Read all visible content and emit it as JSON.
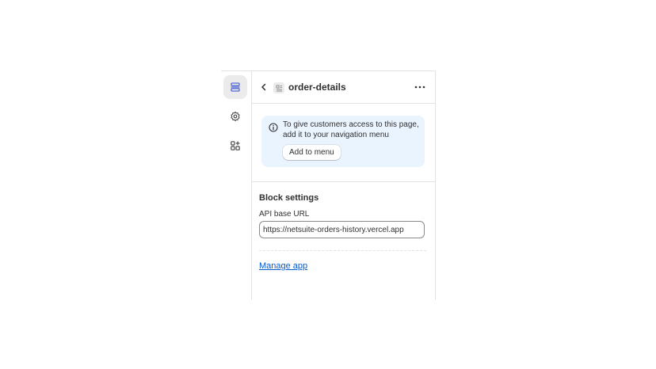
{
  "rail": {
    "items": [
      {
        "name": "sections",
        "icon": "sections-icon",
        "active": true
      },
      {
        "name": "settings",
        "icon": "gear-icon",
        "active": false
      },
      {
        "name": "apps",
        "icon": "app-add-icon",
        "active": false
      }
    ]
  },
  "header": {
    "title": "order-details",
    "back_icon": "chevron-left-icon",
    "page_icon": "page-icon",
    "more_icon": "more-horizontal-icon"
  },
  "banner": {
    "text": "To give customers access to this page, add it to your navigation menu",
    "button_label": "Add to menu",
    "icon": "info-icon"
  },
  "block_settings": {
    "title": "Block settings",
    "field_label": "API base URL",
    "field_value": "https://netsuite-orders-history.vercel.app"
  },
  "footer": {
    "link_label": "Manage app"
  },
  "colors": {
    "accent_link": "#005bd3",
    "banner_bg": "#eaf4ff",
    "active_rail_bg": "#ebebeb",
    "rail_icon": "#4a4a4a"
  }
}
